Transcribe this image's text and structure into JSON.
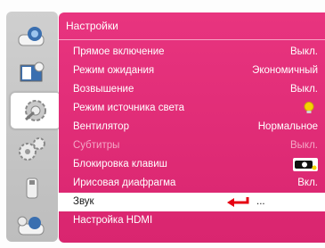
{
  "menu": {
    "title": "Настройки",
    "items": [
      {
        "label": "Прямое включение",
        "value": "Выкл."
      },
      {
        "label": "Режим ожидания",
        "value": "Экономичный"
      },
      {
        "label": "Возвышение",
        "value": "Выкл."
      },
      {
        "label": "Режим источника света",
        "value": ""
      },
      {
        "label": "Вентилятор",
        "value": "Нормальное"
      },
      {
        "label": "Субтитры",
        "value": "Выкл."
      },
      {
        "label": "Блокировка клавиш",
        "value": ""
      },
      {
        "label": "Ирисовая диафрагма",
        "value": "Вкл."
      },
      {
        "label": "Звук",
        "value": "..."
      },
      {
        "label": "Настройка HDMI",
        "value": ""
      }
    ]
  },
  "sidebar": {
    "icons": [
      "projector-icon",
      "picture-adjust-icon",
      "setup-gear-icon",
      "expert-gears-icon",
      "usb-icon",
      "network-icon"
    ]
  },
  "colors": {
    "panel": "#e0307a",
    "selected_row": "#ffffff",
    "disabled_text": "#f4a7c6",
    "arrow": "#e60012",
    "bulb": "#f5d300"
  },
  "selected_index": 8,
  "disabled_index": 5
}
